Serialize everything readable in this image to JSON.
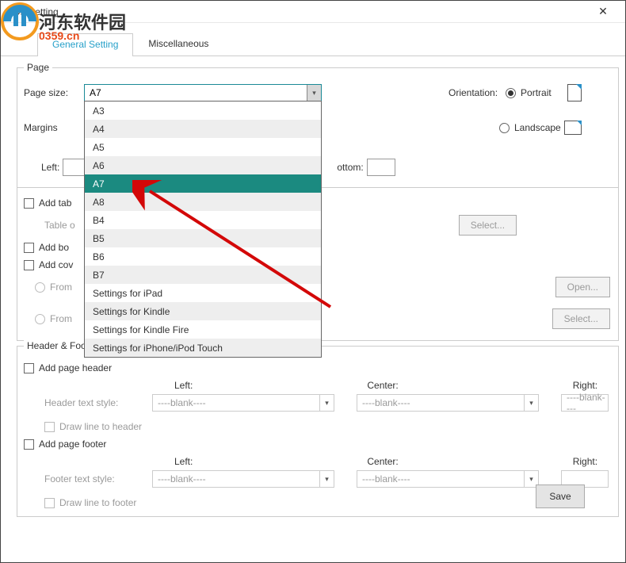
{
  "window": {
    "title": "PDF Setting",
    "close": "✕"
  },
  "watermark": {
    "text": "河东软件园",
    "url": "0359.cn"
  },
  "tabs": {
    "active": "General Setting",
    "other": "Miscellaneous"
  },
  "page": {
    "group_label": "Page",
    "size_label": "Page size:",
    "size_value": "A7",
    "options": [
      "A3",
      "A4",
      "A5",
      "A6",
      "A7",
      "A8",
      "B4",
      "B5",
      "B6",
      "B7",
      "Settings for iPad",
      "Settings for Kindle",
      "Settings for Kindle Fire",
      "Settings for iPhone/iPod Touch"
    ],
    "orientation_label": "Orientation:",
    "portrait": "Portrait",
    "landscape": "Landscape",
    "margins_label": "Margins",
    "left_label": "Left:",
    "bottom_label": "ottom:"
  },
  "opts": {
    "add_table": "Add tab",
    "table_sub": "Table o",
    "select_btn": "Select...",
    "add_bo": "Add  bo",
    "add_cov": "Add cov",
    "from_a": "From",
    "from_b": "From",
    "open_btn": "Open...",
    "select_btn2": "Select..."
  },
  "hf": {
    "group_label": "Header & Footer",
    "add_header": "Add page header",
    "header_style": "Header text style:",
    "draw_header": "Draw line to header",
    "add_footer": "Add page footer",
    "footer_style": "Footer text style:",
    "draw_footer": "Draw line to footer",
    "left": "Left:",
    "center": "Center:",
    "right": "Right:",
    "blank": "----blank----"
  },
  "save": "Save"
}
